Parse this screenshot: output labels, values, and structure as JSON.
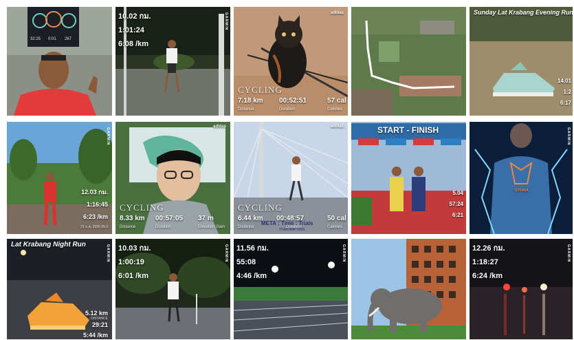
{
  "tiles": {
    "t1": {
      "watch": [
        "32:25",
        "0:01",
        "267"
      ]
    },
    "t2": {
      "brand": "GARMIN",
      "dist": "10.02 กม.",
      "time": "1:01:24",
      "pace": "6:08 /km"
    },
    "t3": {
      "brand": "adidas",
      "mode": "CYCLING",
      "dist": "7.18 km",
      "dur": "00:52:51",
      "cal": "57 cal",
      "l1": "Distance",
      "l2": "Duration",
      "l3": "Calories"
    },
    "t4": {},
    "t5": {
      "title": "Sunday Lat Krabang Evening Run",
      "dist": "14.01",
      "time": "1:2",
      "pace": "6:17"
    },
    "t6": {
      "brand": "GARMIN",
      "dist": "12.03 กม.",
      "time": "1:16:45",
      "pace": "6:23 /km",
      "foot": "21 ก.ค. 2025 05:3"
    },
    "t7": {
      "brand": "adidas",
      "mode": "CYCLING",
      "dist": "8.33 km",
      "dur": "00:57:05",
      "elev": "37 m",
      "l1": "Distance",
      "l2": "Duration",
      "l3": "Elevation Gain"
    },
    "t8": {
      "brand": "adidas",
      "mode": "CYCLING",
      "dist": "6.44 km",
      "dur": "00:48:57",
      "cal": "50 cal",
      "l1": "Distance",
      "l2": "Duration",
      "l3": "Calories",
      "meta": "META : Time : Trials",
      "meta2": "THAILAND 2025"
    },
    "t9": {
      "banner": "START - FINISH",
      "dist": "5.04",
      "time": "57:24",
      "pace": "6:21"
    },
    "t10": {
      "brand": "GARMIN",
      "tag": "STRAVA"
    },
    "t11": {
      "title": "Lat Krabang Night Run",
      "brand": "GARMIN",
      "dist": "5.12 km",
      "time": "29:21",
      "pace": "5:44 /km",
      "l1": "DISTANCE"
    },
    "t12": {
      "brand": "GARMIN",
      "dist": "10.03 กม.",
      "time": "1:00:19",
      "pace": "6:01 /km"
    },
    "t13": {
      "brand": "GARMIN",
      "dist": "11.56 กม.",
      "time": "55:08",
      "pace": "4:46 /km"
    },
    "t14": {},
    "t15": {
      "brand": "GARMIN",
      "dist": "12.26 กม.",
      "time": "1:18:27",
      "pace": "6:24 /km"
    }
  }
}
